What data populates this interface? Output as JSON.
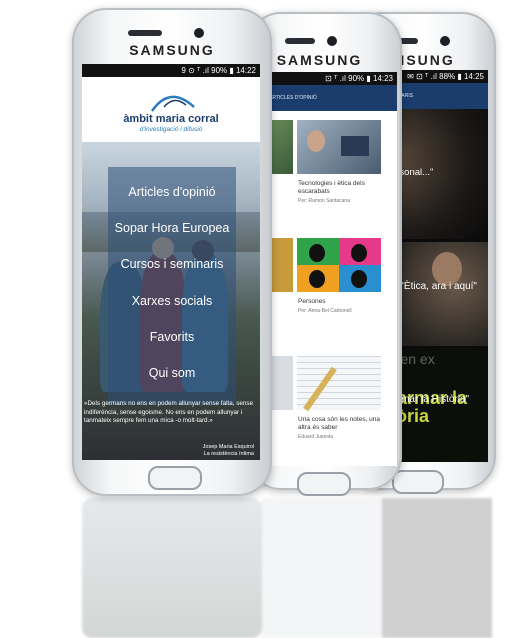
{
  "phone_brand": "SAMSUNG",
  "phone1": {
    "status": "9 ⊙ ᵀ .ıl 90% ▮ 14:22",
    "logo_main": "àmbit maria corral",
    "logo_sub": "d'investigació i difusió",
    "menu": [
      "Articles d'opinió",
      "Sopar Hora Europea",
      "Cursos i seminaris",
      "Xarxes socials",
      "Favorits",
      "Qui som"
    ],
    "quote": "«Dels germans no ens en podem allunyar sense falta, sense indiferència, sense egoisme. No ens en podem allunyar i tanmateix sempre fem una mica -o molt-tard.»",
    "quote_author": "Josep Maria Esquirol",
    "quote_source": "La resistència íntima"
  },
  "phone2": {
    "status": "⊡ ᵀ .ıl 90% ▮ 14:23",
    "title": "ARTICLES D'OPINIÓ",
    "cards": [
      {
        "title": "Tecnologies i ètica dels escarabats",
        "author": "Per: Ramon Santacana"
      },
      {
        "title": "Persones",
        "author": "Per: Anna-Bel Carbonell"
      },
      {
        "title": "Una cosa són les notes, una altra és saber",
        "author": "Eduard Juanola"
      }
    ]
  },
  "phone3": {
    "status": "✉ ⊡ ᵀ .ıl 88% ▮ 14:25",
    "title": "CURSOS I SEMINARIS",
    "tiles": [
      {
        "text": "...ment personal...\""
      },
      {
        "text": "Curs \"L'Ètica, ara i aquí\""
      },
      {
        "text": "\"Desarmar la Història\"",
        "bg_text": "Desarmar la història",
        "bg_text2": "armer en ex"
      }
    ]
  },
  "colors": {
    "brand_blue": "#1a3d6e",
    "accent": "#2a7ac0"
  }
}
